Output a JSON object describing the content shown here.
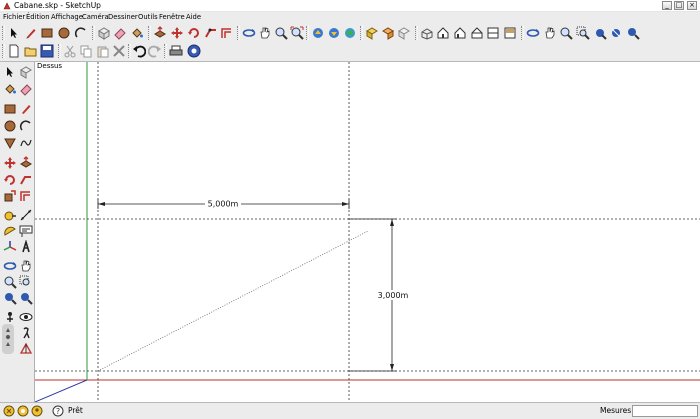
{
  "window": {
    "title": "Cabane.skp - SketchUp",
    "controls": {
      "minimize": "_",
      "maximize": "□",
      "close": "×"
    }
  },
  "menu": [
    "Fichier",
    "Édition",
    "Affichage",
    "Caméra",
    "Dessiner",
    "Outils",
    "Fenêtre",
    "Aide"
  ],
  "toolbar_row1": [
    "select-icon",
    "pencil-line-icon",
    "rectangle-icon",
    "circle-icon",
    "arc-icon",
    "make-component-icon",
    "eraser-icon",
    "paint-bucket-icon",
    "push-pull-icon",
    "move-icon",
    "rotate-icon",
    "follow-me-icon",
    "orbit-icon",
    "pan-icon",
    "zoom-icon",
    "zoom-extents-icon",
    "get-models-icon",
    "share-model-icon",
    "google-earth-icon",
    "make-component-icon-2",
    "iso-view-icon",
    "top-view-icon",
    "front-view-icon",
    "right-view-icon",
    "back-view-icon",
    "left-view-icon",
    "orbit-icon-2",
    "pan-icon-2",
    "zoom-icon-2",
    "zoom-window-icon",
    "previous-view-icon",
    "next-view-icon",
    "zoom-extents-icon-2"
  ],
  "toolbar_row2": [
    "new-file-icon",
    "open-file-icon",
    "save-file-icon",
    "cut-icon",
    "copy-icon",
    "paste-icon",
    "delete-icon",
    "undo-icon",
    "redo-icon",
    "print-icon",
    "model-info-icon"
  ],
  "sidebar_tools": [
    "select-icon",
    "make-component-icon",
    "paint-bucket-icon",
    "eraser-icon",
    "rectangle-icon",
    "pencil-line-icon",
    "circle-icon",
    "arc-icon",
    "polygon-icon",
    "freehand-icon",
    "move-icon",
    "push-pull-icon",
    "rotate-icon",
    "follow-me-icon",
    "scale-icon",
    "offset-icon",
    "tape-measure-icon",
    "dimension-icon",
    "protractor-icon",
    "text-icon",
    "axes-icon",
    "3d-text-icon",
    "orbit-icon",
    "pan-icon",
    "zoom-icon",
    "zoom-window-icon",
    "zoom-extents-icon",
    "previous-view-icon",
    "position-camera-icon",
    "look-around-icon",
    "walk-icon",
    "section-plane-icon"
  ],
  "viewport": {
    "scene_label": "Dessus",
    "dimensions": {
      "horizontal": "5,000m",
      "vertical": "3,000m"
    }
  },
  "status": {
    "icons": [
      "geolocation-icon",
      "credits-icon",
      "user-icon",
      "help-icon"
    ],
    "message": "Prêt",
    "measurements_label": "Mesures",
    "measurements_value": ""
  },
  "colors": {
    "chrome": "#ececec",
    "red_axis": "#c0322d",
    "green_axis": "#2e9a3e",
    "blue_axis": "#2c36a8",
    "guide": "#333333"
  }
}
